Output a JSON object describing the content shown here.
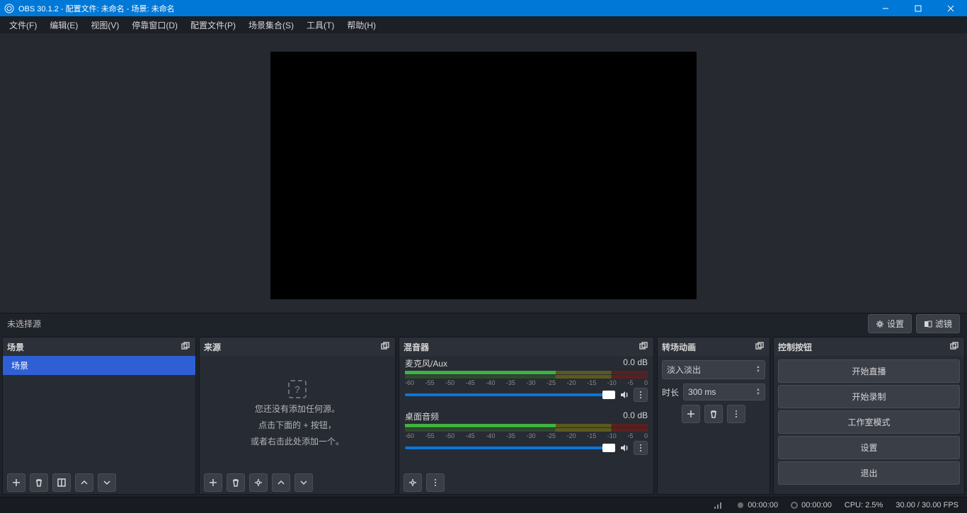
{
  "titlebar": {
    "title": "OBS 30.1.2 - 配置文件: 未命名 - 场景: 未命名"
  },
  "menu": {
    "file": "文件(F)",
    "edit": "编辑(E)",
    "view": "视图(V)",
    "dock": "停靠窗口(D)",
    "profile": "配置文件(P)",
    "scene_collection": "场景集合(S)",
    "tools": "工具(T)",
    "help": "帮助(H)"
  },
  "toolbar": {
    "no_source": "未选择源",
    "settings": "设置",
    "filters": "滤镜"
  },
  "scenes": {
    "header": "场景",
    "items": [
      "场景"
    ]
  },
  "sources": {
    "header": "来源",
    "empty1": "您还没有添加任何源。",
    "empty2": "点击下面的 + 按钮，",
    "empty3": "或者右击此处添加一个。"
  },
  "mixer": {
    "header": "混音器",
    "ch1_name": "麦克风/Aux",
    "ch1_db": "0.0 dB",
    "ch2_name": "桌面音频",
    "ch2_db": "0.0 dB",
    "scale": [
      "-60",
      "-55",
      "-50",
      "-45",
      "-40",
      "-35",
      "-30",
      "-25",
      "-20",
      "-15",
      "-10",
      "-5",
      "0"
    ]
  },
  "transitions": {
    "header": "转场动画",
    "selected": "淡入淡出",
    "duration_label": "时长",
    "duration_value": "300 ms"
  },
  "controls": {
    "header": "控制按钮",
    "start_stream": "开始直播",
    "start_record": "开始录制",
    "studio_mode": "工作室模式",
    "settings": "设置",
    "exit": "退出"
  },
  "status": {
    "live_time": "00:00:00",
    "rec_time": "00:00:00",
    "cpu": "CPU: 2.5%",
    "fps": "30.00 / 30.00 FPS"
  }
}
